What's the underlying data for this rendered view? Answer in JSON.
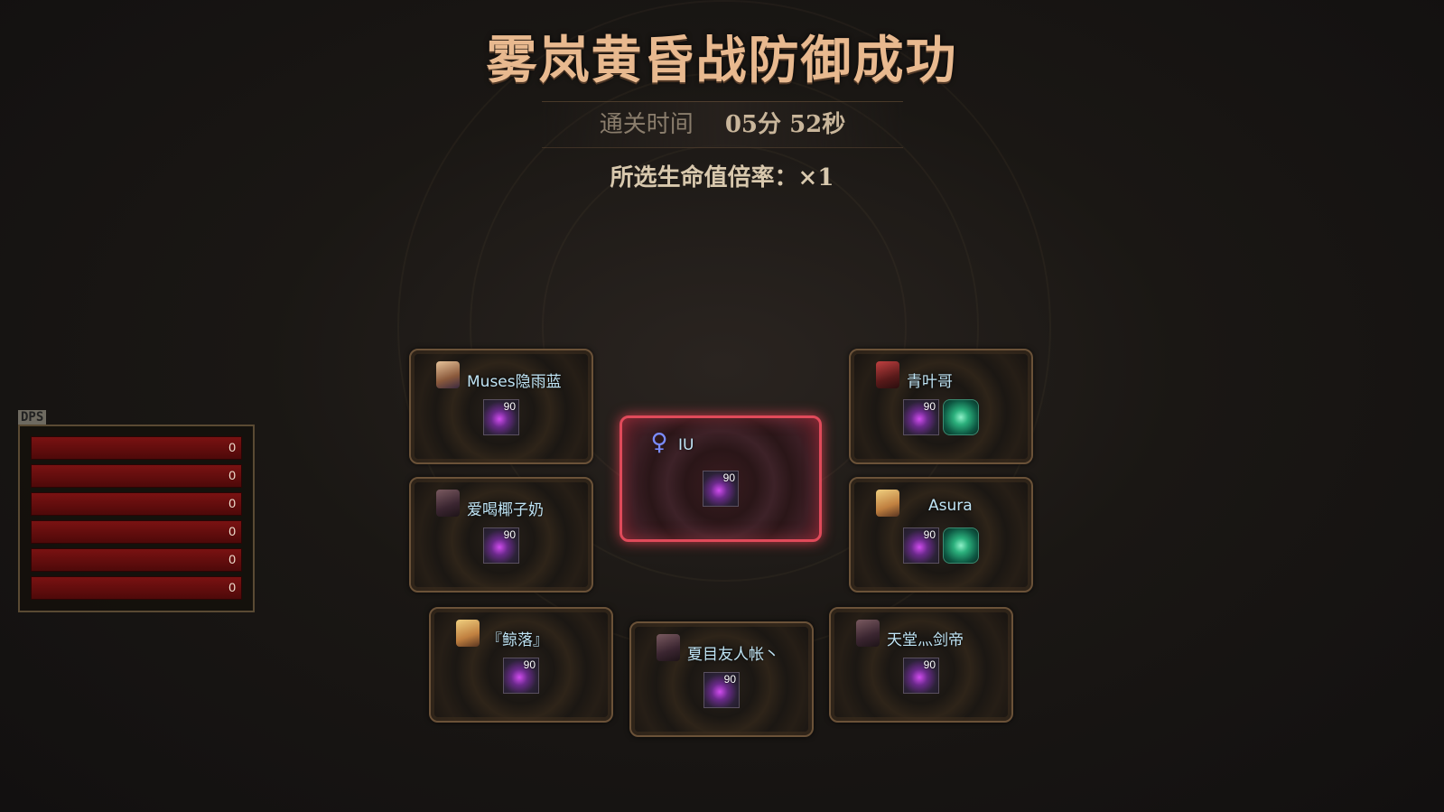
{
  "header": {
    "title": "雾岚黄昏战防御成功",
    "clear_time_label": "通关时间",
    "clear_time_value": "05分 52秒",
    "hp_multiplier": "所选生命值倍率：×1"
  },
  "dps_panel": {
    "label": "DPS",
    "values": [
      "0",
      "0",
      "0",
      "0",
      "0",
      "0"
    ]
  },
  "players": [
    {
      "name": "Muses隐雨蓝",
      "level": "90",
      "extra_item": false,
      "avatar_icon": "character-portrait"
    },
    {
      "name": "爱喝椰子奶",
      "level": "90",
      "extra_item": false,
      "avatar_icon": "character-portrait"
    },
    {
      "name": "IU",
      "level": "90",
      "extra_item": false,
      "avatar_icon": "location-pin-icon"
    },
    {
      "name": "青叶哥",
      "level": "90",
      "extra_item": true,
      "avatar_icon": "character-portrait"
    },
    {
      "name": "Asura",
      "level": "90",
      "extra_item": true,
      "avatar_icon": "character-portrait"
    },
    {
      "name": "『鲸落』",
      "level": "90",
      "extra_item": false,
      "avatar_icon": "character-portrait"
    },
    {
      "name": "夏目友人帐丶",
      "level": "90",
      "extra_item": false,
      "avatar_icon": "character-portrait"
    },
    {
      "name": "天堂灬剑帝",
      "level": "90",
      "extra_item": false,
      "avatar_icon": "character-portrait"
    }
  ],
  "colors": {
    "title": "#e8b98f",
    "highlight_border": "#e04a5a",
    "dps_bar": "#7a1212",
    "player_name": "#bfe4f5"
  }
}
